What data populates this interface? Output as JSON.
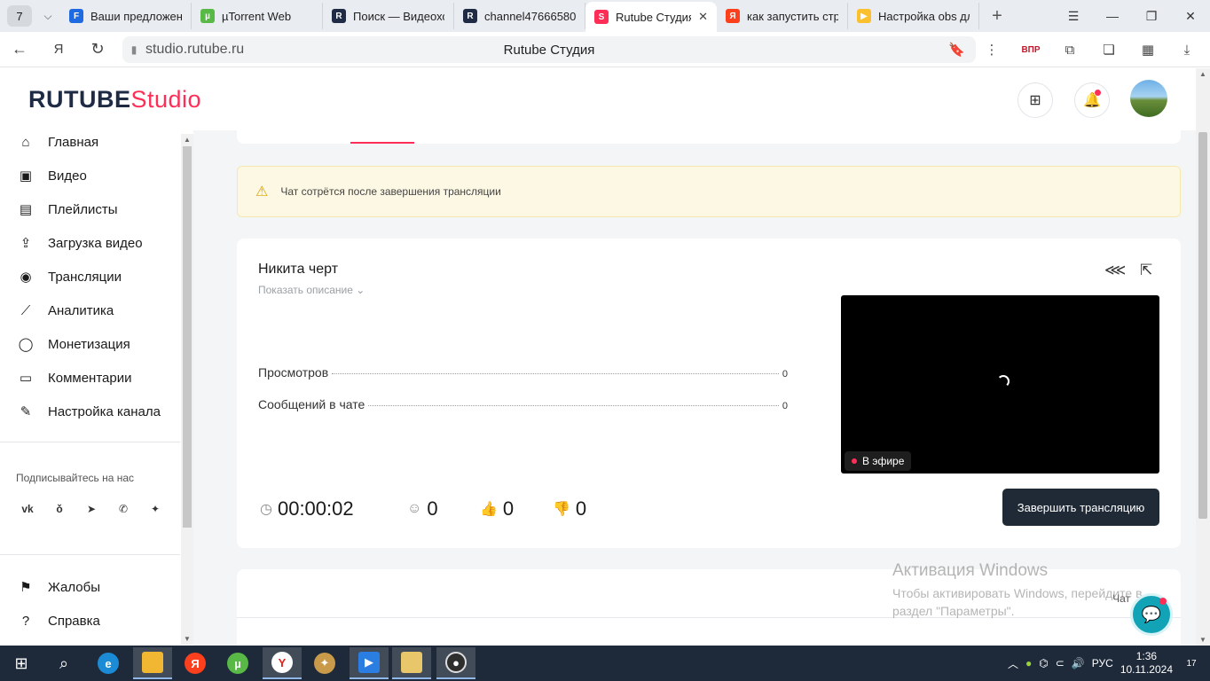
{
  "browser": {
    "tab_count": "7",
    "tabs": [
      {
        "label": "Ваши предложения",
        "color": "#1e6ae0",
        "glyph": "F"
      },
      {
        "label": "µTorrent Web",
        "color": "#58b947",
        "glyph": "µ"
      },
      {
        "label": "Поиск — Видеохостинг",
        "color": "#1f2a44",
        "glyph": "R"
      },
      {
        "label": "channel47666580",
        "color": "#1f2a44",
        "glyph": "R"
      },
      {
        "label": "Rutube Студия",
        "color": "#ff2e57",
        "glyph": "S"
      },
      {
        "label": "как запустить стрим",
        "color": "#fc3f1d",
        "glyph": "Я"
      },
      {
        "label": "Настройка obs для",
        "color": "#fbc02d",
        "glyph": "▶"
      }
    ],
    "url": "studio.rutube.ru",
    "page_title": "Rutube Студия",
    "vpn_label": "ВПР"
  },
  "logo": {
    "word": "RUTUBE",
    "studio": "Studio"
  },
  "sidebar": {
    "items": [
      {
        "label": "Главная",
        "icon": "home-icon"
      },
      {
        "label": "Видео",
        "icon": "video-icon"
      },
      {
        "label": "Плейлисты",
        "icon": "playlist-icon"
      },
      {
        "label": "Загрузка видео",
        "icon": "upload-icon"
      },
      {
        "label": "Трансляции",
        "icon": "broadcast-icon"
      },
      {
        "label": "Аналитика",
        "icon": "analytics-icon"
      },
      {
        "label": "Монетизация",
        "icon": "monetization-icon"
      },
      {
        "label": "Комментарии",
        "icon": "comments-icon"
      },
      {
        "label": "Настройка канала",
        "icon": "channel-settings-icon"
      }
    ],
    "subscribe_title": "Подписывайтесь на нас",
    "socials": [
      "vk",
      "ok",
      "telegram",
      "viber",
      "more"
    ],
    "bottom_items": [
      {
        "label": "Жалобы",
        "icon": "complaints-icon"
      },
      {
        "label": "Справка",
        "icon": "help-icon"
      }
    ]
  },
  "warning": {
    "text": "Чат сотрётся после завершения трансляции"
  },
  "stream": {
    "title": "Никита черт",
    "show_description": "Показать описание",
    "stats": [
      {
        "label": "Просмотров",
        "value": "0"
      },
      {
        "label": "Сообщений в чате",
        "value": "0"
      }
    ],
    "live_label": "В эфире",
    "duration": "00:00:02",
    "viewers": "0",
    "likes": "0",
    "dislikes": "0",
    "end_button": "Завершить трансляцию"
  },
  "chat": {
    "label": "Чат"
  },
  "activation": {
    "title": "Активация Windows",
    "text": "Чтобы активировать Windows, перейдите в раздел \"Параметры\"."
  },
  "taskbar": {
    "language": "РУС",
    "time": "1:36",
    "date": "10.11.2024",
    "notifications": "17"
  },
  "colors": {
    "accent": "#ff2e57",
    "dark_button": "#1f2a36",
    "warning_bg": "#fdf8e4"
  }
}
